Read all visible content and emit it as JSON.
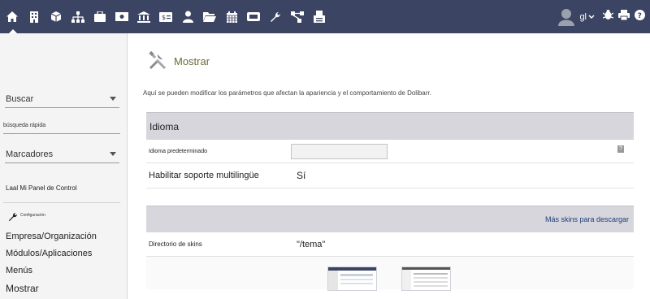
{
  "topbar": {
    "nav_icons": [
      "home-icon",
      "building-icon",
      "box-icon",
      "sitemap-icon",
      "briefcase-icon",
      "money-icon",
      "bank-icon",
      "invoice-icon",
      "user-icon",
      "folder-open-icon",
      "calendar-icon",
      "ticket-icon",
      "wrench-icon",
      "nodes-icon",
      "print-queue-icon"
    ],
    "user_code": "gl",
    "right_icons": [
      "bug-icon",
      "print-icon",
      "help-icon"
    ],
    "bg_color": "#3b4462"
  },
  "sidebar": {
    "search_label": "Buscar",
    "quick_search_placeholder": "búsqueda rápida",
    "bookmarks_label": "Marcadores",
    "dashboard_link": "Laal Mi Panel de Control",
    "config_label": "Configuración",
    "menu": [
      "Empresa/Organización",
      "Módulos/Aplicaciones",
      "Menús",
      "Mostrar"
    ]
  },
  "main": {
    "title": "Mostrar",
    "description": "Aquí se pueden modificar los parámetros que afectan la apariencia y el comportamiento de Dolibarr.",
    "language_section": {
      "header": "Idioma",
      "default_language_label": "Idioma predeterminado",
      "default_language_value": "",
      "multilang_label": "Habilitar soporte multilingüe",
      "multilang_value": "Sí"
    },
    "skins_section": {
      "download_link": "Más skins para descargar",
      "skins_dir_label": "Directorio de skins",
      "skins_dir_value": "\"/tema\""
    }
  }
}
